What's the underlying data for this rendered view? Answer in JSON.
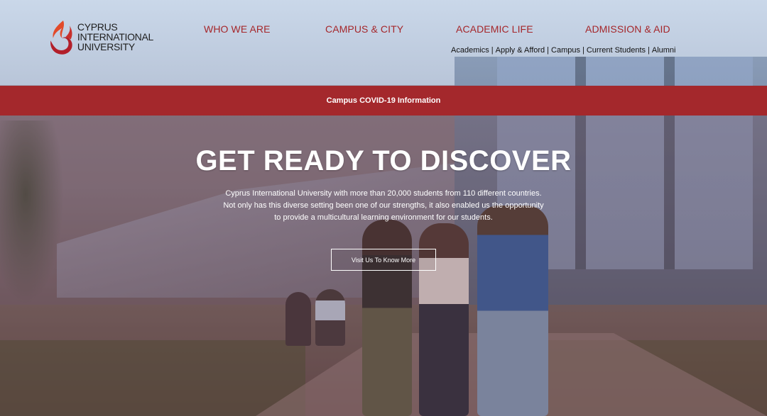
{
  "brand": {
    "logo_lines": [
      "CYPRUS",
      "INTERNATIONAL",
      "UNIVERSITY"
    ],
    "colors": {
      "primary": "#a5262a",
      "logo_orange": "#e24a2a",
      "logo_red": "#b21f2a"
    }
  },
  "nav": {
    "main": [
      {
        "label": "WHO WE ARE"
      },
      {
        "label": "CAMPUS & CITY"
      },
      {
        "label": "ACADEMIC LIFE"
      },
      {
        "label": "ADMISSION & AID"
      }
    ],
    "sub": [
      {
        "label": "Academics"
      },
      {
        "label": "Apply & Afford"
      },
      {
        "label": "Campus"
      },
      {
        "label": "Current Students"
      },
      {
        "label": "Alumni"
      }
    ],
    "sub_separator": "|"
  },
  "banner": {
    "label": "Campus COVID-19 Information"
  },
  "hero": {
    "title": "GET READY TO DISCOVER",
    "description_lines": [
      "Cyprus International University with more than 20,000 students from 110 different countries.",
      "Not only has this diverse setting been one of our strengths, it also enabled us the opportunity",
      "to provide a multicultural learning environment for our students."
    ],
    "cta_label": "Visit Us To Know More"
  }
}
